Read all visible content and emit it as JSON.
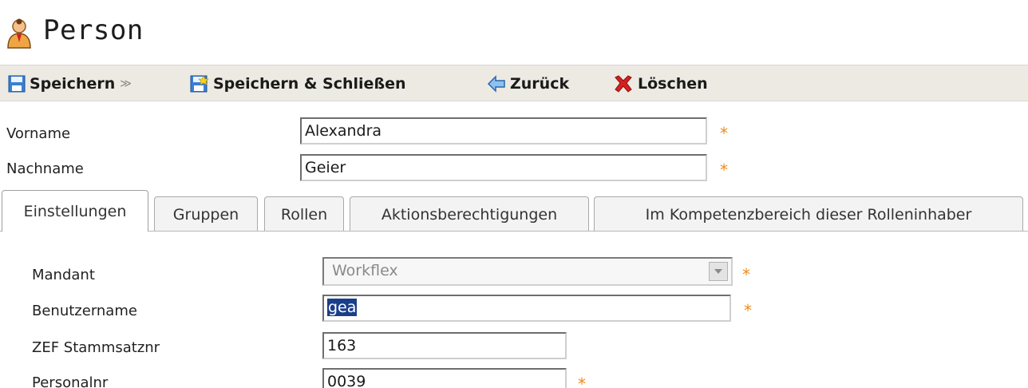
{
  "header": {
    "title": "Person",
    "icon": "person-icon"
  },
  "toolbar": {
    "save_label": "Speichern",
    "save_caret": "≫",
    "save_close_label": "Speichern & Schließen",
    "back_label": "Zurück",
    "delete_label": "Löschen"
  },
  "form": {
    "vorname": {
      "label": "Vorname",
      "value": "Alexandra",
      "required": "*"
    },
    "nachname": {
      "label": "Nachname",
      "value": "Geier",
      "required": "*"
    }
  },
  "tabs": [
    {
      "label": "Einstellungen",
      "active": true
    },
    {
      "label": "Gruppen"
    },
    {
      "label": "Rollen"
    },
    {
      "label": "Aktionsberechtigungen"
    },
    {
      "label": "Im Kompetenzbereich dieser Rolleninhaber"
    }
  ],
  "settings": {
    "mandant": {
      "label": "Mandant",
      "value": "Workflex",
      "required": "*"
    },
    "benutzername": {
      "label": "Benutzername",
      "value": "gea",
      "required": "*"
    },
    "zef": {
      "label": "ZEF Stammsatznr",
      "value": "163"
    },
    "personalnr": {
      "label": "Personalnr",
      "value": "0039",
      "required": "*"
    }
  },
  "colors": {
    "toolbar_bg": "#eceae2",
    "required_star": "#f08a17",
    "selection": "#1b3e8b",
    "delete_red": "#d42020"
  }
}
